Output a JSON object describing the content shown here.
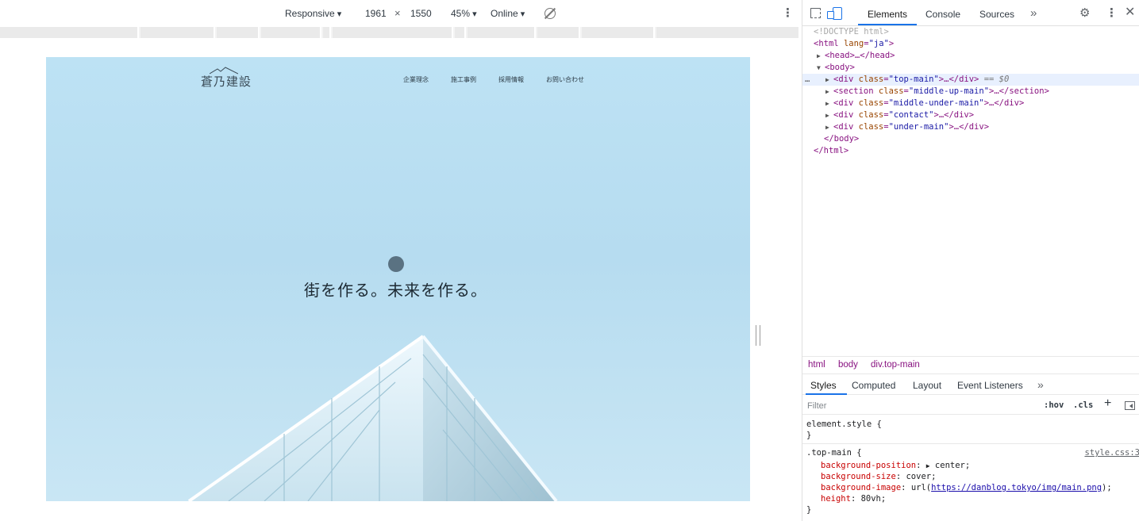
{
  "device_toolbar": {
    "mode": "Responsive",
    "width": "1961",
    "times": "×",
    "height": "1550",
    "zoom": "45%",
    "throttling": "Online",
    "rotate_icon": "rotate-icon",
    "more_icon": "kebab-icon"
  },
  "site": {
    "logo_text": "蒼乃建設",
    "nav": [
      "企業理念",
      "施工事例",
      "採用情報",
      "お問い合わせ"
    ],
    "hero_text": "街を作る。未来を作る。",
    "colors": {
      "sky": "#bde2f4",
      "text": "#1d2a33"
    }
  },
  "devtools": {
    "tabs": [
      "Elements",
      "Console",
      "Sources"
    ],
    "active_tab": "Elements",
    "more_tabs": "»",
    "dom": {
      "doctype": "<!DOCTYPE html>",
      "html_open": {
        "tag": "html",
        "attr": "lang",
        "value": "ja"
      },
      "head": {
        "text": "<head>…</head>"
      },
      "body_open": "<body>",
      "children": [
        {
          "tag": "div",
          "class": "top-main",
          "suffix": "…</div>",
          "selected_marker": "== $0"
        },
        {
          "tag": "section",
          "class": "middle-up-main",
          "suffix": "…</section>"
        },
        {
          "tag": "div",
          "class": "middle-under-main",
          "suffix": "…</div>"
        },
        {
          "tag": "div",
          "class": "contact",
          "suffix": "…</div>"
        },
        {
          "tag": "div",
          "class": "under-main",
          "suffix": "…</div>"
        }
      ],
      "body_close": "</body>",
      "html_close": "</html>",
      "ellipsis": "…"
    },
    "breadcrumbs": [
      "html",
      "body",
      "div.top-main"
    ],
    "sub_tabs": [
      "Styles",
      "Computed",
      "Layout",
      "Event Listeners"
    ],
    "sub_more": "»",
    "active_sub_tab": "Styles",
    "filter_placeholder": "Filter",
    "hov": ":hov",
    "cls": ".cls",
    "plus": "+",
    "styles": {
      "element_style_open": "element.style {",
      "element_style_close": "}",
      "rule_selector": ".top-main {",
      "rule_source": "style.css:3",
      "declarations": [
        {
          "prop": "background-position",
          "value": "center;",
          "expandable": true
        },
        {
          "prop": "background-size",
          "value": "cover;"
        },
        {
          "prop": "background-image",
          "value_prefix": "url(",
          "url": "https://danblog.tokyo/img/main.png",
          "value_suffix": ");"
        },
        {
          "prop": "height",
          "value": "80vh;"
        }
      ],
      "rule_close": "}"
    }
  }
}
